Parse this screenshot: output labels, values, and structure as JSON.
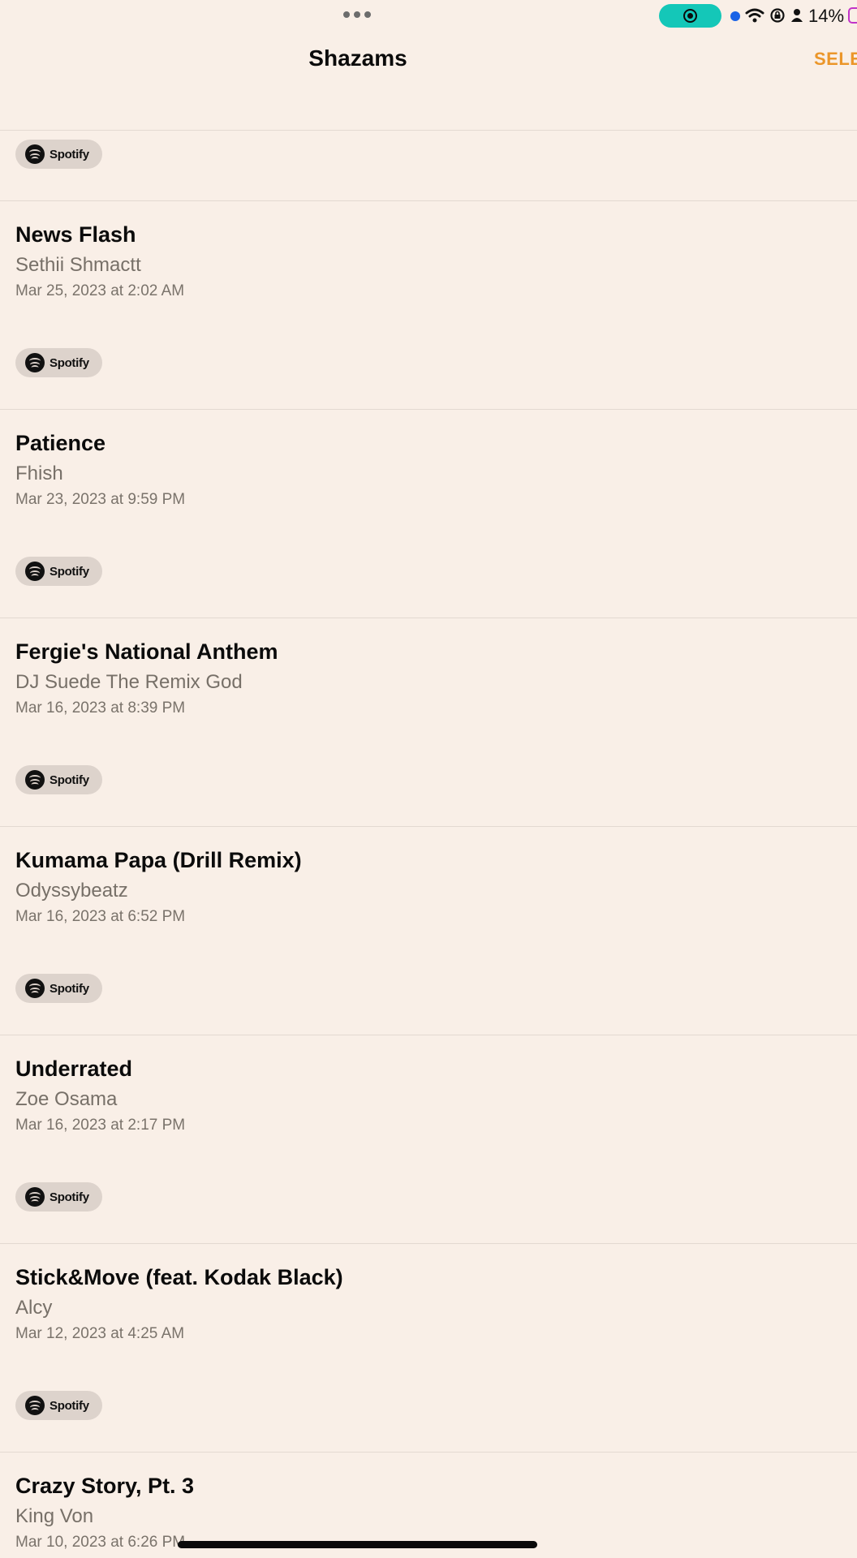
{
  "status_bar": {
    "battery_percent": "14%",
    "recording_active": true,
    "icons": [
      "more-dots-icon",
      "screen-record-icon",
      "location-dot-icon",
      "wifi-icon",
      "rotation-lock-icon",
      "person-icon",
      "battery-icon"
    ]
  },
  "nav": {
    "title": "Shazams",
    "select_label": "SELE"
  },
  "colors": {
    "background": "#f9efe7",
    "accent": "#eb962a",
    "record_pill": "#14c7b8",
    "spotify_pill": "#ddd3cc"
  },
  "spotify_label": "Spotify",
  "tracks": [
    {
      "title": "News Flash",
      "artist": "Sethii Shmactt",
      "date": "Mar 25, 2023 at 2:02 AM"
    },
    {
      "title": "Patience",
      "artist": "Fhish",
      "date": "Mar 23, 2023 at 9:59 PM"
    },
    {
      "title": "Fergie's National Anthem",
      "artist": "DJ Suede The Remix God",
      "date": "Mar 16, 2023 at 8:39 PM"
    },
    {
      "title": "Kumama Papa (Drill Remix)",
      "artist": "Odyssybeatz",
      "date": "Mar 16, 2023 at 6:52 PM"
    },
    {
      "title": "Underrated",
      "artist": "Zoe Osama",
      "date": "Mar 16, 2023 at 2:17 PM"
    },
    {
      "title": "Stick&Move (feat. Kodak Black)",
      "artist": "Alcy",
      "date": "Mar 12, 2023 at 4:25 AM"
    },
    {
      "title": "Crazy Story, Pt. 3",
      "artist": "King Von",
      "date": "Mar 10, 2023 at 6:26 PM"
    }
  ]
}
